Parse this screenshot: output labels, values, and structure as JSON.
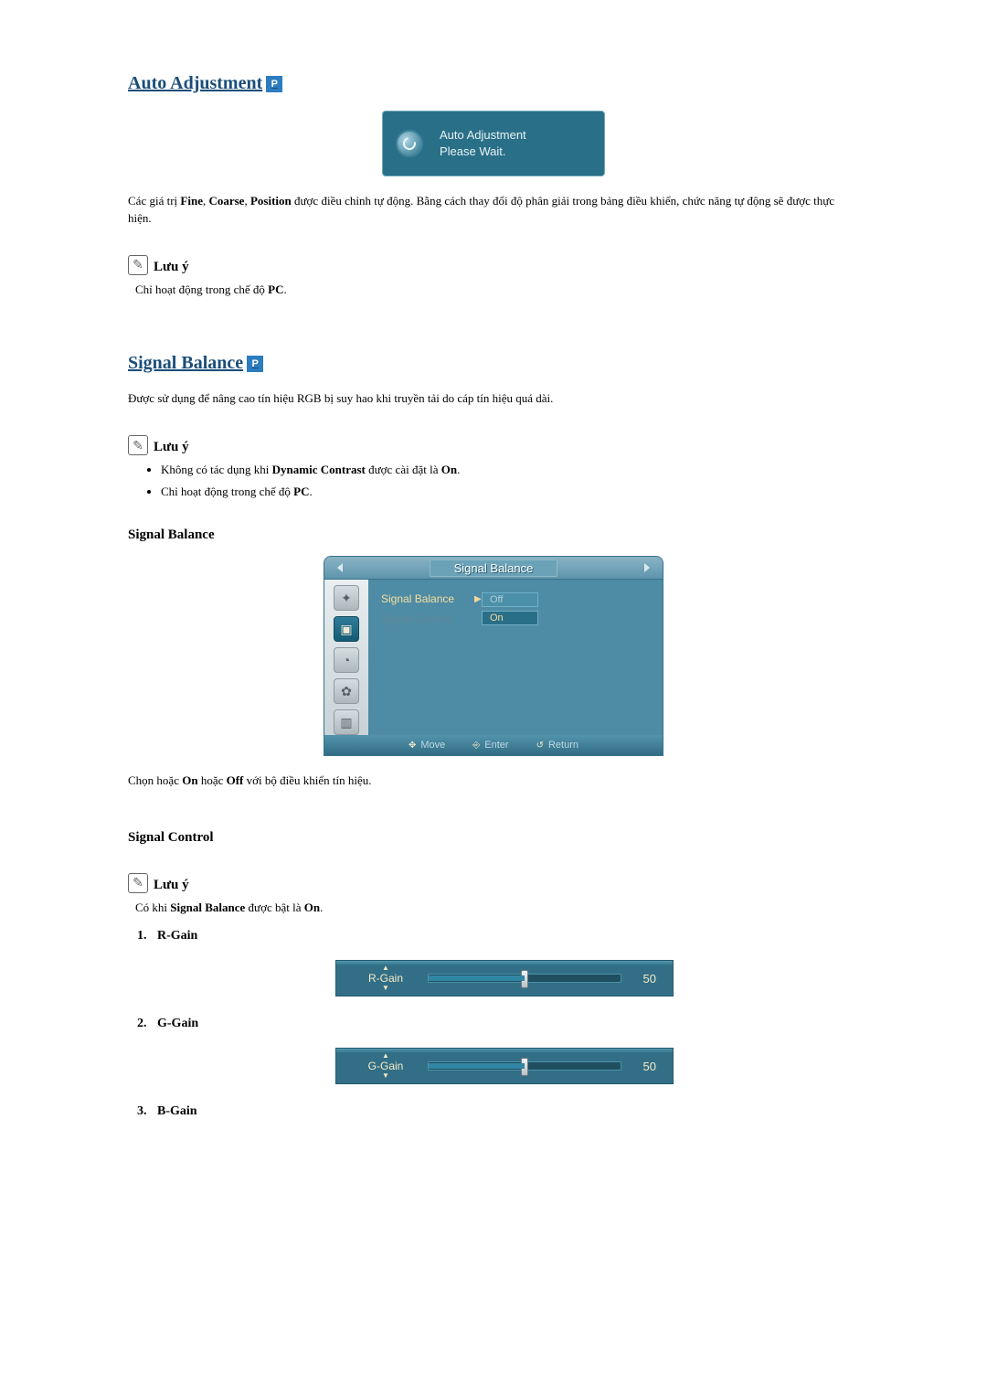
{
  "auto_adjustment": {
    "heading": "Auto Adjustment",
    "p_badge": "P",
    "popup": {
      "line1": "Auto Adjustment",
      "line2": "Please Wait."
    },
    "desc_parts": {
      "p1": "Các giá trị ",
      "b1": "Fine",
      "s1": ", ",
      "b2": "Coarse",
      "s2": ", ",
      "b3": "Position",
      "p2": " được điều chỉnh tự động. Bằng cách thay đổi độ phân giải trong bảng điều khiển, chức năng tự động sẽ được thực hiện."
    },
    "note": {
      "label": "Lưu ý",
      "body_parts": {
        "t1": "Chỉ hoạt động trong chế độ ",
        "b1": "PC",
        "t2": "."
      }
    }
  },
  "signal_balance": {
    "heading": "Signal Balance",
    "p_badge": "P",
    "desc": "Được sử dụng để nâng cao tín hiệu RGB bị suy hao khi truyền tải do cáp tín hiệu quá dài.",
    "note": {
      "label": "Lưu ý",
      "li1": {
        "t1": "Không có tác dụng khi ",
        "b1": "Dynamic Contrast",
        "t2": " được cài đặt là ",
        "b2": "On",
        "t3": "."
      },
      "li2": {
        "t1": "Chỉ hoạt động trong chế độ ",
        "b1": "PC",
        "t2": "."
      }
    },
    "subhead": "Signal Balance",
    "osd": {
      "title": "Signal Balance",
      "labels": {
        "sel": "Signal Balance",
        "dim": "Signal Control"
      },
      "values": {
        "off": "Off",
        "on": "On"
      },
      "footer": {
        "move": "Move",
        "enter": "Enter",
        "return": "Return"
      }
    },
    "choose_parts": {
      "t1": "Chọn hoặc ",
      "b1": "On",
      "t2": " hoặc ",
      "b2": "Off",
      "t3": " với bộ điều khiển tín hiệu."
    }
  },
  "signal_control": {
    "subhead": "Signal Control",
    "note": {
      "label": "Lưu ý",
      "body_parts": {
        "t1": "Có khi ",
        "b1": "Signal Balance",
        "t2": " được bật là ",
        "b2": "On",
        "t3": "."
      }
    },
    "gains": {
      "r": {
        "label": "R-Gain",
        "slider_label": "R-Gain",
        "value": "50"
      },
      "g": {
        "label": "G-Gain",
        "slider_label": "G-Gain",
        "value": "50"
      },
      "b": {
        "label": "B-Gain"
      }
    }
  }
}
